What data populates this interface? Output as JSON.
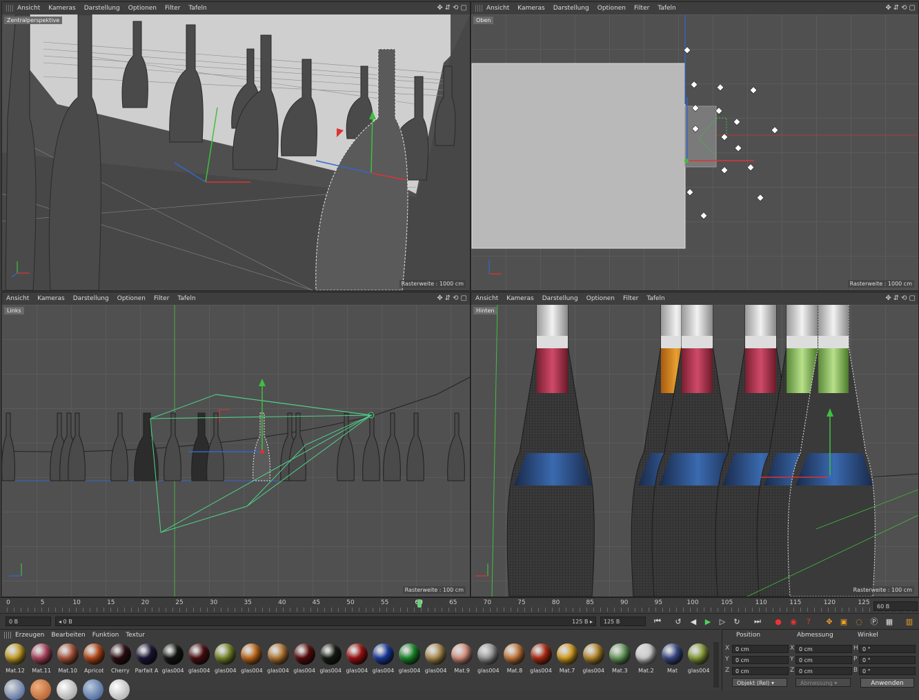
{
  "viewport_menu": [
    "Ansicht",
    "Kameras",
    "Darstellung",
    "Optionen",
    "Filter",
    "Tafeln"
  ],
  "viewports": {
    "tl": {
      "label": "Zentralperspektive",
      "footer": "Rasterweite : 1000 cm"
    },
    "tr": {
      "label": "Oben",
      "footer": "Rasterweite : 1000 cm"
    },
    "bl": {
      "label": "Links",
      "footer": "Rasterweite : 100 cm"
    },
    "br": {
      "label": "Hinten",
      "footer": "Rasterweite : 100 cm"
    }
  },
  "timeline": {
    "ticks": [
      "0",
      "5",
      "10",
      "15",
      "20",
      "25",
      "30",
      "35",
      "40",
      "45",
      "50",
      "55",
      "60",
      "65",
      "70",
      "75",
      "80",
      "85",
      "90",
      "95",
      "100",
      "105",
      "110",
      "115",
      "120",
      "125"
    ],
    "current": "60"
  },
  "controls": {
    "start_field": "0 B",
    "slider_min": "◂ 0 B",
    "slider_max": "125 B ▸",
    "end_field": "125 B",
    "fps_field": "60 B"
  },
  "material_menu": [
    "Erzeugen",
    "Bearbeiten",
    "Funktion",
    "Textur"
  ],
  "materials": [
    {
      "name": "Mat.12",
      "color": "#c9a227"
    },
    {
      "name": "Mat.11",
      "color": "#b04560"
    },
    {
      "name": "Mat.10",
      "color": "#b0553a"
    },
    {
      "name": "Apricot",
      "color": "#b84a18"
    },
    {
      "name": "Cherry",
      "color": "#2a0a10"
    },
    {
      "name": "Parfait A",
      "color": "#1a1436"
    },
    {
      "name": "glas004",
      "color": "#101410"
    },
    {
      "name": "glas004",
      "color": "#4a0c10"
    },
    {
      "name": "glas004",
      "color": "#7a8a2a"
    },
    {
      "name": "glas004",
      "color": "#c46a1a"
    },
    {
      "name": "glas004",
      "color": "#b87a34"
    },
    {
      "name": "glas004",
      "color": "#5a0a0a"
    },
    {
      "name": "glas004",
      "color": "#141a10"
    },
    {
      "name": "glas004",
      "color": "#a01010"
    },
    {
      "name": "glas004",
      "color": "#1a3aa0"
    },
    {
      "name": "glas004",
      "color": "#1a8a2a"
    },
    {
      "name": "glas004",
      "color": "#b09050"
    },
    {
      "name": "Mat.9",
      "color": "#d89080"
    },
    {
      "name": "glas004",
      "color": "#9a9a9a"
    },
    {
      "name": "Mat.8",
      "color": "#c87a3a"
    },
    {
      "name": "glas004",
      "color": "#b02a10"
    },
    {
      "name": "Mat.7",
      "color": "#d8a020"
    },
    {
      "name": "glas004",
      "color": "#b88a2a"
    },
    {
      "name": "Mat.3",
      "color": "#6aa060"
    },
    {
      "name": "Mat.2",
      "color": "#cfcfcf"
    },
    {
      "name": "Mat",
      "color": "#3a4a8a"
    },
    {
      "name": "glas004",
      "color": "#8aa03a"
    }
  ],
  "attributes": {
    "headers": [
      "Position",
      "Abmessung",
      "Winkel"
    ],
    "rows": [
      {
        "axis": "X",
        "pos": "0 cm",
        "dim_axis": "X",
        "dim": "0 cm",
        "ang_axis": "H",
        "ang": "0 °"
      },
      {
        "axis": "Y",
        "pos": "0 cm",
        "dim_axis": "Y",
        "dim": "0 cm",
        "ang_axis": "P",
        "ang": "0 °"
      },
      {
        "axis": "Z",
        "pos": "0 cm",
        "dim_axis": "Z",
        "dim": "0 cm",
        "ang_axis": "B",
        "ang": "0 °"
      }
    ],
    "mode": "Objekt (Rel)",
    "size_mode": "Abmessung",
    "apply": "Anwenden"
  }
}
